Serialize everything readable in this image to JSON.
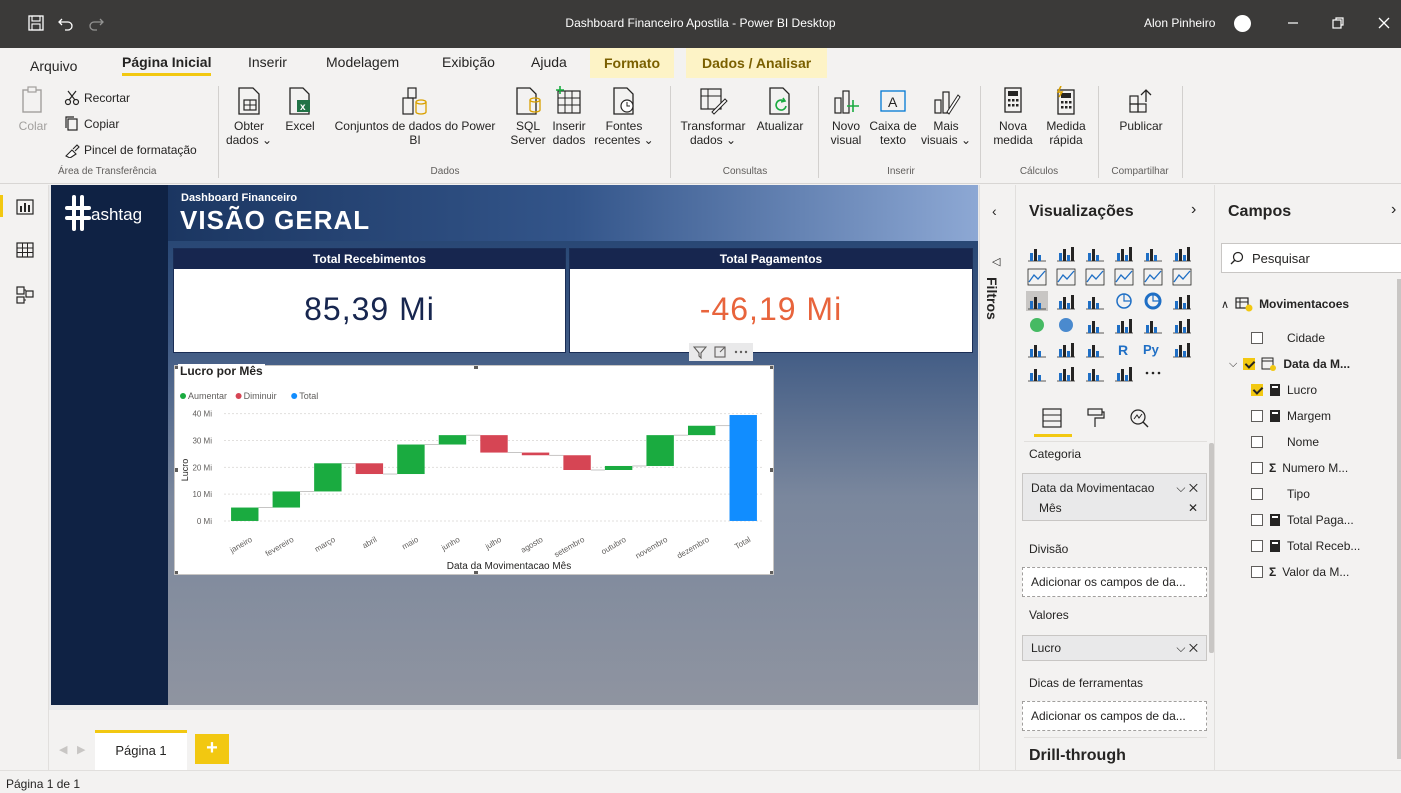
{
  "window": {
    "title": "Dashboard Financeiro Apostila - Power BI Desktop",
    "user": "Alon Pinheiro"
  },
  "tabs": {
    "arquivo": "Arquivo",
    "inicial": "Página Inicial",
    "inserir": "Inserir",
    "modelagem": "Modelagem",
    "exibicao": "Exibição",
    "ajuda": "Ajuda",
    "formato": "Formato",
    "dados": "Dados / Analisar"
  },
  "ribbon": {
    "colar": "Colar",
    "recortar": "Recortar",
    "copiar": "Copiar",
    "pincel": "Pincel de formatação",
    "g_transfer": "Área de Transferência",
    "obter1": "Obter",
    "obter2": "dados ⌄",
    "excel": "Excel",
    "conj1": "Conjuntos de dados do Power",
    "conj2": "BI",
    "sql1": "SQL",
    "sql2": "Server",
    "inserir1": "Inserir",
    "inserir2": "dados",
    "fontes1": "Fontes",
    "fontes2": "recentes ⌄",
    "g_dados": "Dados",
    "transf1": "Transformar",
    "transf2": "dados ⌄",
    "atual": "Atualizar",
    "g_consultas": "Consultas",
    "novo1": "Novo",
    "novo2": "visual",
    "caixa1": "Caixa de",
    "caixa2": "texto",
    "mais1": "Mais",
    "mais2": "visuais ⌄",
    "g_inserir": "Inserir",
    "nova1": "Nova",
    "nova2": "medida",
    "med1": "Medida",
    "med2": "rápida",
    "g_calc": "Cálculos",
    "publicar": "Publicar",
    "g_comp": "Compartilhar"
  },
  "report": {
    "logo": "ashtag",
    "subtitle": "Dashboard Financeiro",
    "title": "VISÃO GERAL",
    "card1": {
      "label": "Total Recebimentos",
      "value": "85,39 Mi"
    },
    "card2": {
      "label": "Total Pagamentos",
      "value": "-46,19 Mi"
    },
    "chart": {
      "title": "Lucro por Mês",
      "legend": [
        "Aumentar",
        "Diminuir",
        "Total"
      ]
    }
  },
  "chart_data": {
    "type": "waterfall",
    "title": "Lucro por Mês",
    "xlabel": "Data da Movimentacao Mês",
    "ylabel": "Lucro",
    "categories": [
      "janeiro",
      "fevereiro",
      "março",
      "abril",
      "maio",
      "junho",
      "julho",
      "agosto",
      "setembro",
      "outubro",
      "novembro",
      "dezembro",
      "Total"
    ],
    "values": [
      5,
      6,
      10.5,
      -4,
      11,
      3.5,
      -6.5,
      -1,
      -5.5,
      1.5,
      11.5,
      3.5,
      39.5
    ],
    "ylim": [
      -3,
      41
    ],
    "yticks": [
      "0 Mi",
      "10 Mi",
      "20 Mi",
      "30 Mi",
      "40 Mi"
    ],
    "colors": {
      "increase": "#1aab40",
      "decrease": "#d64554",
      "total": "#118dff"
    },
    "legend_position": "top-left"
  },
  "pages": {
    "page1": "Página 1",
    "status": "Página 1 de 1"
  },
  "filters": {
    "label": "Filtros"
  },
  "viz": {
    "title": "Visualizações",
    "categoria": "Categoria",
    "cat_field1": "Data da Movimentacao",
    "cat_field2": "Mês",
    "divisao": "Divisão",
    "add1": "Adicionar os campos de da...",
    "valores": "Valores",
    "val_field": "Lucro",
    "dicas": "Dicas de ferramentas",
    "add2": "Adicionar os campos de da...",
    "drill": "Drill-through"
  },
  "fields": {
    "title": "Campos",
    "search_placeholder": "Pesquisar",
    "table": "Movimentacoes",
    "items": [
      "Cidade",
      "Data da M...",
      "Lucro",
      "Margem",
      "Nome",
      "Numero M...",
      "Tipo",
      "Total Paga...",
      "Total Receb...",
      "Valor da M..."
    ]
  }
}
